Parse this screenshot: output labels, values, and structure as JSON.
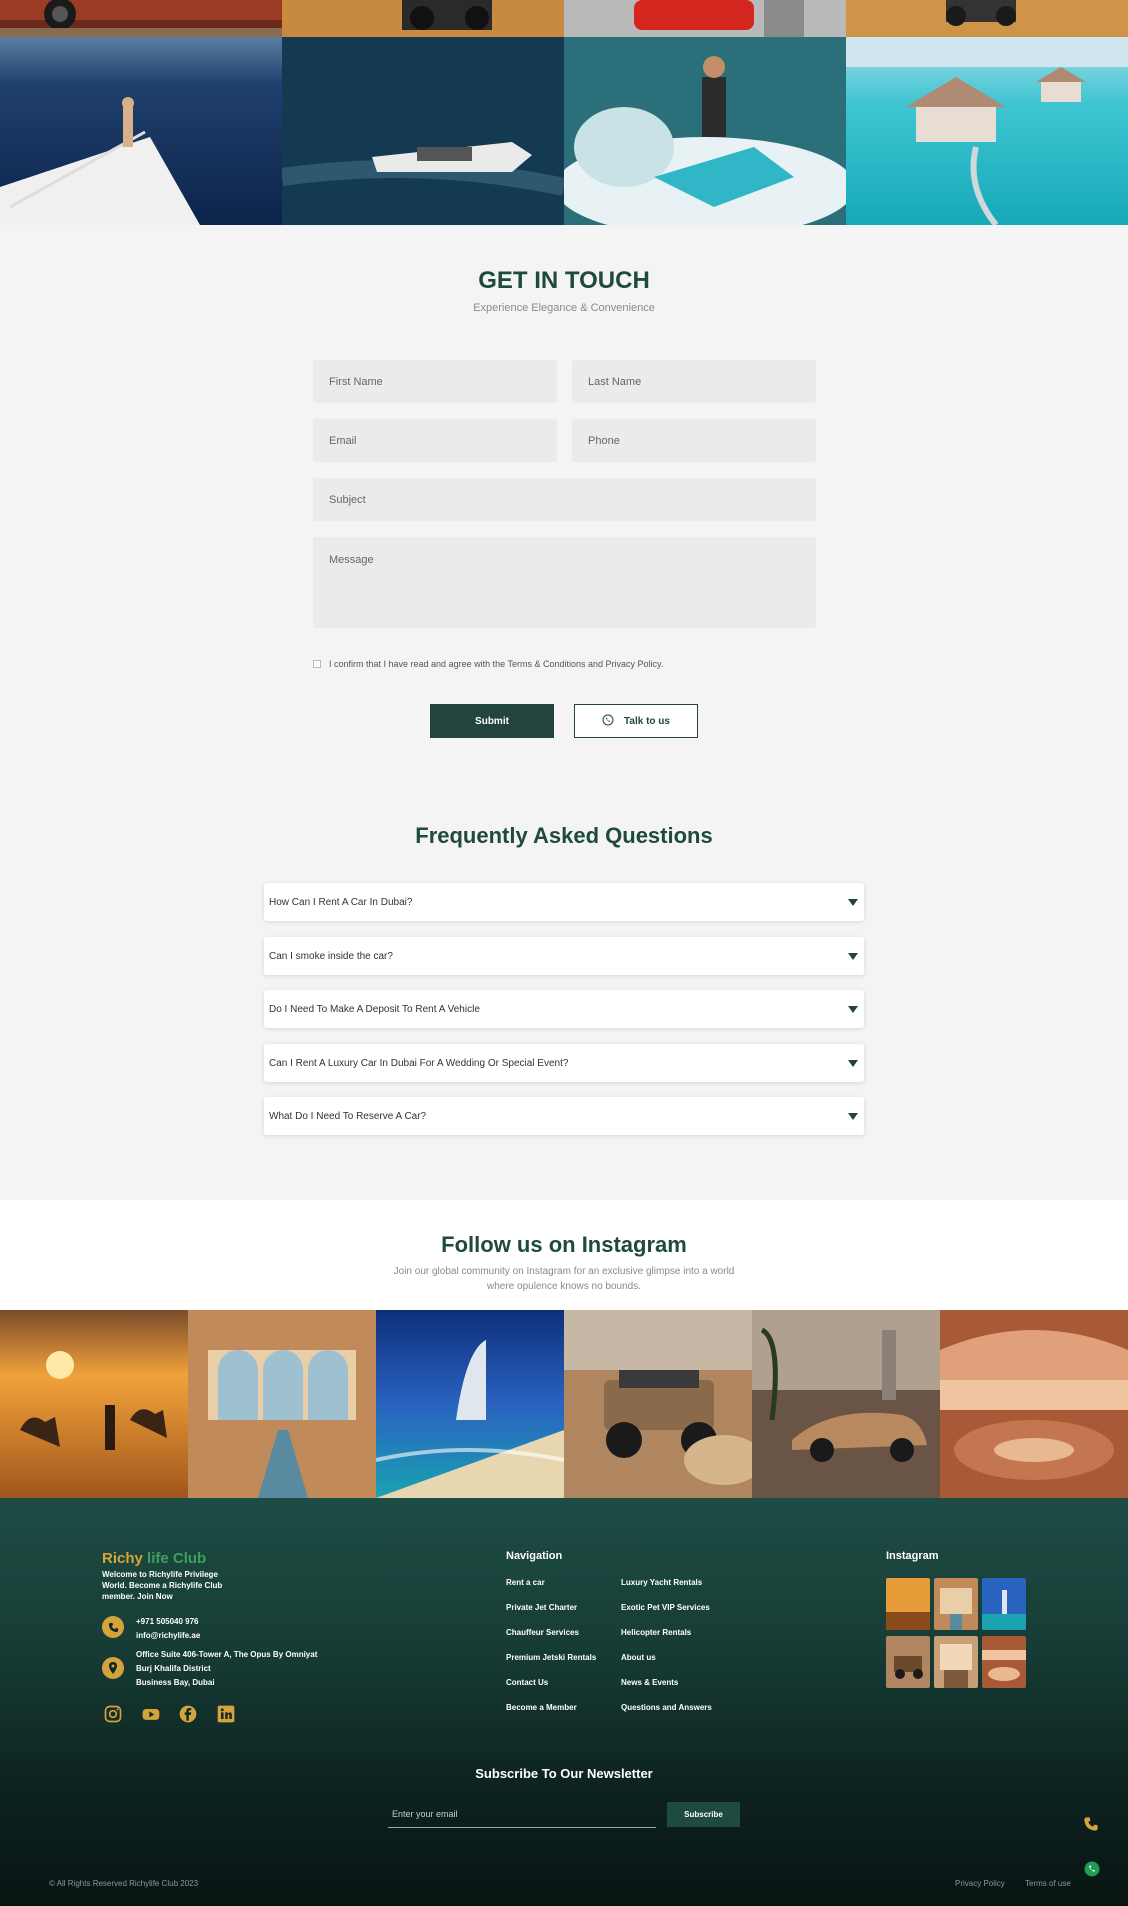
{
  "contact": {
    "title": "GET IN TOUCH",
    "subtitle": "Experience Elegance & Convenience",
    "placeholders": {
      "first_name": "First Name",
      "last_name": "Last Name",
      "email": "Email",
      "phone": "Phone",
      "subject": "Subject",
      "message": "Message"
    },
    "consent": "I confirm that I have read and agree with the Terms & Conditions and Privacy Policy.",
    "submit_label": "Submit",
    "talk_label": "Talk to us"
  },
  "faq": {
    "title": "Frequently Asked Questions",
    "items": [
      "How Can I Rent A Car In Dubai?",
      "Can I smoke inside the car?",
      "Do I Need To Make A Deposit To Rent A Vehicle",
      "Can I Rent A Luxury Car In Dubai For A Wedding Or Special Event?",
      "What Do I Need To Reserve A Car?"
    ]
  },
  "instagram": {
    "title": "Follow us on Instagram",
    "subtitle_line1": "Join our global community on Instagram for an exclusive glimpse into a world",
    "subtitle_line2": "where opulence knows no bounds."
  },
  "footer": {
    "logo_part1": "Richy",
    "logo_part2": "life Club",
    "intro": "Welcome to Richylife Privilege World. Become a Richylife Club member. Join Now",
    "phone": "+971 505040 976",
    "email": "info@richylife.ae",
    "address_line1": "Office Suite 406-Tower A, The Opus By Omniyat",
    "address_line2": "Burj Khalifa District",
    "address_line3": "Business Bay, Dubai",
    "nav_title": "Navigation",
    "nav_col1": [
      "Rent a car",
      "Private Jet Charter",
      "Chauffeur Services",
      "Premium Jetski Rentals",
      "Contact Us",
      "Become a Member"
    ],
    "nav_col2": [
      "Luxury Yacht Rentals",
      "Exotic Pet VIP Services",
      "Helicopter Rentals",
      "About us",
      "News & Events",
      "Questions and Answers"
    ],
    "insta_title": "Instagram",
    "newsletter_title": "Subscribe To Our Newsletter",
    "newsletter_placeholder": "Enter your email",
    "subscribe_label": "Subscribe",
    "copyright": "© All Rights Reserved Richylife Club 2023",
    "privacy": "Privacy Policy",
    "terms": "Terms of use"
  },
  "colors": {
    "brand_dark_green": "#23443c",
    "gold": "#d6a33a",
    "logo_green": "#3ea05c"
  }
}
